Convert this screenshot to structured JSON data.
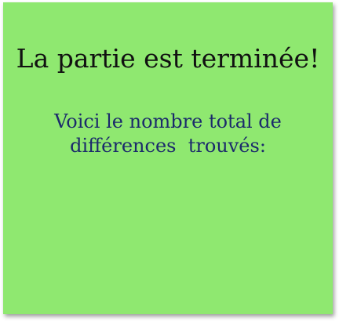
{
  "dialog": {
    "title": "La partie est terminée!",
    "message_line1": "Voici le nombre total de",
    "message_line2": "différences  trouvés:"
  },
  "colors": {
    "card_background": "#8fe870",
    "title_text": "#111111",
    "message_text": "#1b2a6b"
  }
}
